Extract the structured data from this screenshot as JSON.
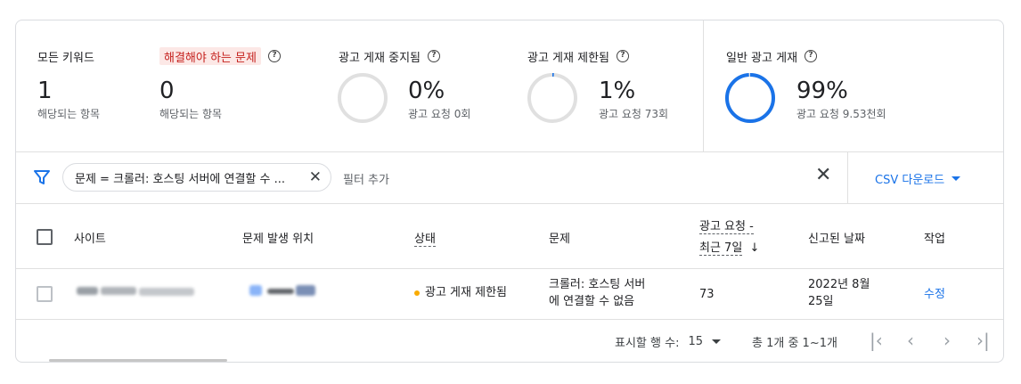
{
  "summary": {
    "all_keywords": {
      "label": "모든 키워드",
      "value": "1",
      "sub": "해당되는 항목"
    },
    "issues": {
      "label": "해결해야 하는 문제",
      "value": "0",
      "sub": "해당되는 항목"
    },
    "suspended": {
      "label": "광고 게재 중지됨",
      "value": "0%",
      "sub": "광고 요청 0회",
      "ring_fraction": 0.0
    },
    "limited": {
      "label": "광고 게재 제한됨",
      "value": "1%",
      "sub": "광고 요청 73회",
      "ring_fraction": 0.01
    },
    "normal": {
      "label": "일반 광고 게재",
      "value": "99%",
      "sub": "광고 요청 9.53천회",
      "ring_fraction": 0.99
    },
    "help_icon": "?"
  },
  "filter": {
    "chip_text": "문제 = 크롤러: 호스팅 서버에 연결할 수 ...",
    "add_filter": "필터 추가",
    "csv_label": "CSV 다운로드"
  },
  "table": {
    "headers": {
      "site": "사이트",
      "location": "문제 발생 위치",
      "status": "상태",
      "issue": "문제",
      "requests_line1": "광고 요청 -",
      "requests_line2": "최근 7일",
      "sort_arrow": "↓",
      "reported": "신고된 날짜",
      "action": "작업"
    },
    "rows": [
      {
        "status": "광고 게재 제한됨",
        "issue_line1": "크롤러: 호스팅 서버",
        "issue_line2": "에 연결할 수 없음",
        "requests": "73",
        "date_line1": "2022년 8월",
        "date_line2": "25일",
        "action": "수정"
      }
    ]
  },
  "pagination": {
    "rows_label": "표시할 행 수:",
    "rows_value": "15",
    "count_text": "총 1개 중 1~1개"
  },
  "colors": {
    "accent": "#1a73e8",
    "issue_highlight_bg": "#fce8e6",
    "issue_highlight_text": "#c5221f",
    "status_dot": "#f9ab00",
    "ring_track": "#e0e0e0"
  }
}
